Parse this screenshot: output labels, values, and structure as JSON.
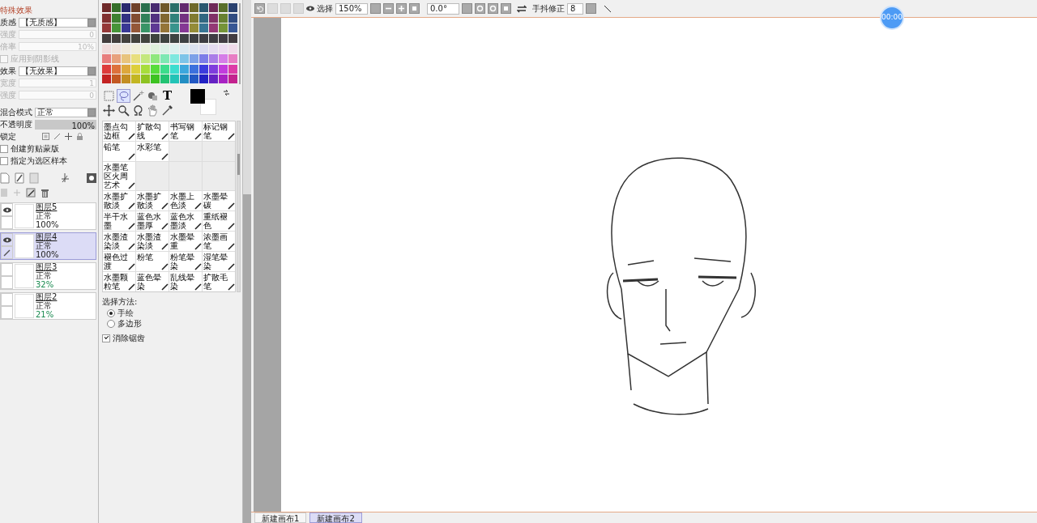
{
  "effects_panel": {
    "title": "特殊效果",
    "texture": {
      "label": "质感",
      "value": "【无质感】"
    },
    "texture_params": [
      {
        "label": "强度",
        "value": "0",
        "disabled": true
      },
      {
        "label": "倍率",
        "value": "10%",
        "disabled": true
      }
    ],
    "apply_hatching": {
      "label": "应用到阴影线",
      "checked": false,
      "disabled": true
    },
    "effect": {
      "label": "效果",
      "value": "【无效果】"
    },
    "effect_params": [
      {
        "label": "宽度",
        "value": "1",
        "disabled": true
      },
      {
        "label": "强度",
        "value": "0",
        "disabled": true
      }
    ]
  },
  "layer_props": {
    "blend_label": "混合模式",
    "blend_value": "正常",
    "opacity_label": "不透明度",
    "opacity": {
      "level": 1,
      "reading": "100%"
    },
    "lock_label": "锁定",
    "options": [
      {
        "label": "创建剪贴蒙版",
        "checked": false
      },
      {
        "label": "指定为选区样本",
        "checked": false
      }
    ]
  },
  "layers": [
    {
      "name": "图层5",
      "mode": "正常",
      "opacity": "100%",
      "visible": true,
      "editing": false,
      "selected": false
    },
    {
      "name": "图层4",
      "mode": "正常",
      "opacity": "100%",
      "visible": true,
      "editing": true,
      "selected": true
    },
    {
      "name": "图层3",
      "mode": "正常",
      "opacity": "32%",
      "visible": false,
      "editing": false,
      "selected": false
    },
    {
      "name": "图层2",
      "mode": "正常",
      "opacity": "21%",
      "visible": false,
      "editing": false,
      "selected": false
    }
  ],
  "tools": [
    {
      "kind": "rect-select",
      "selected": false
    },
    {
      "kind": "lasso",
      "selected": true
    },
    {
      "kind": "wand",
      "selected": false
    },
    {
      "kind": "shape",
      "selected": false
    },
    {
      "kind": "text",
      "label": "T",
      "selected": false
    },
    {
      "kind": "move",
      "selected": false
    },
    {
      "kind": "zoom",
      "selected": false
    },
    {
      "kind": "rotate",
      "selected": false
    },
    {
      "kind": "hand",
      "selected": false
    },
    {
      "kind": "eyedropper",
      "selected": false
    }
  ],
  "brushes": [
    {
      "name": "墨点勾边框"
    },
    {
      "name": "扩散勾线"
    },
    {
      "name": "书写钢笔"
    },
    {
      "name": "标记钢笔"
    },
    {
      "name": "铅笔"
    },
    {
      "name": "水彩笔"
    },
    {
      "kind": "empty"
    },
    {
      "kind": "empty"
    },
    {
      "name": "水墨笔区火周艺术"
    },
    {
      "kind": "empty"
    },
    {
      "kind": "empty"
    },
    {
      "kind": "empty"
    },
    {
      "name": "水墨扩散淡"
    },
    {
      "name": "水墨扩散淡"
    },
    {
      "name": "水墨上色淡"
    },
    {
      "name": "水墨晕碳"
    },
    {
      "name": "半干水墨"
    },
    {
      "name": "蓝色水墨厚"
    },
    {
      "name": "蓝色水墨淡"
    },
    {
      "name": "重纸褪色"
    },
    {
      "name": "水墨渣染淡"
    },
    {
      "name": "水墨渣染淡"
    },
    {
      "name": "水墨晕重"
    },
    {
      "name": "浓墨画笔"
    },
    {
      "name": "褪色过渡"
    },
    {
      "name": "粉笔"
    },
    {
      "name": "粉笔晕染"
    },
    {
      "name": "湿笔晕染"
    },
    {
      "name": "水墨颗粒笔"
    },
    {
      "name": "蓝色晕染"
    },
    {
      "name": "乱线晕染"
    },
    {
      "name": "扩散毛笔"
    }
  ],
  "selection": {
    "label": "选择方法:",
    "methods": [
      {
        "label": "手绘",
        "selected": true
      },
      {
        "label": "多边形",
        "selected": false
      }
    ],
    "antialias": {
      "label": "消除锯齿",
      "checked": true
    }
  },
  "toolbar": {
    "view_label": "选择",
    "zoom": "150%",
    "angle": "0.0°",
    "stabilizer_label": "手抖修正",
    "stabilizer": "8"
  },
  "canvas_tabs": [
    {
      "title": "新建画布1",
      "selected": false
    },
    {
      "title": "新建画布2",
      "selected": true
    }
  ],
  "timer": "00:00"
}
